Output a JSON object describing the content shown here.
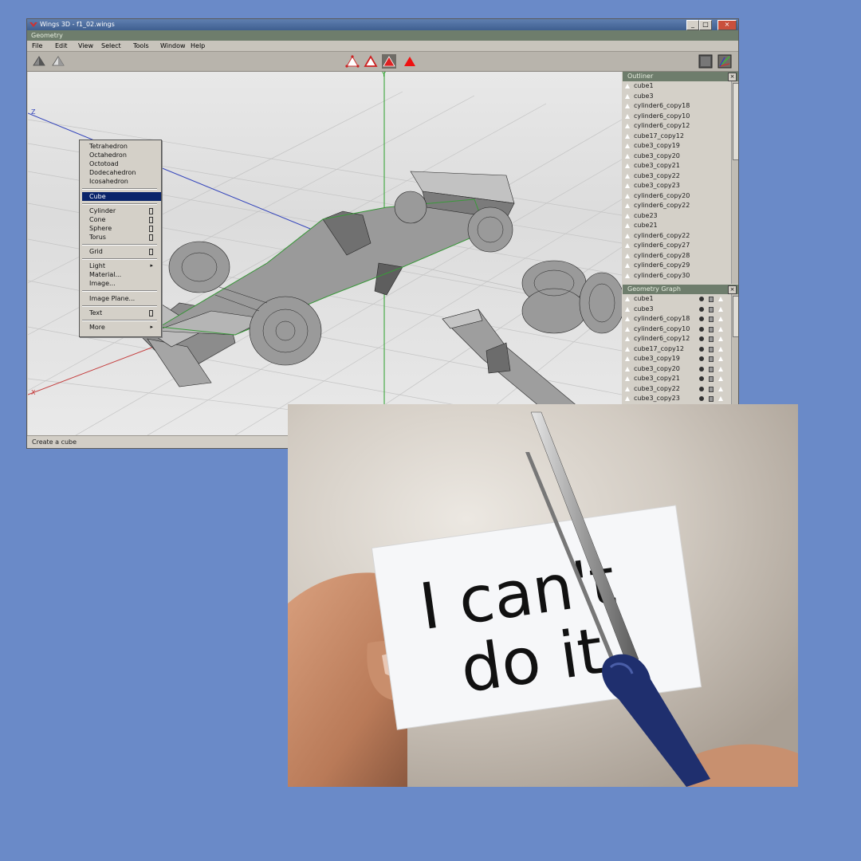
{
  "window": {
    "title": "Wings 3D - f1_02.wings",
    "geometry_bar": "Geometry",
    "controls": [
      "_",
      "□",
      "×"
    ]
  },
  "menubar": [
    "File",
    "Edit",
    "View",
    "Select",
    "Tools",
    "Window",
    "Help"
  ],
  "viewport": {
    "axis_labels": {
      "y": "Y",
      "z": "Z",
      "x": "X"
    }
  },
  "context_menu": {
    "items": [
      {
        "label": "Tetrahedron"
      },
      {
        "label": "Octahedron"
      },
      {
        "label": "Octotoad"
      },
      {
        "label": "Dodecahedron"
      },
      {
        "label": "Icosahedron"
      },
      {
        "label": "Cube",
        "highlighted": true
      },
      {
        "label": "Cylinder",
        "option_box": true
      },
      {
        "label": "Cone",
        "option_box": true
      },
      {
        "label": "Sphere",
        "option_box": true
      },
      {
        "label": "Torus",
        "option_box": true
      },
      {
        "label": "Grid",
        "option_box": true
      },
      {
        "label": "Light",
        "submenu": true
      },
      {
        "label": "Material..."
      },
      {
        "label": "Image..."
      },
      {
        "label": "Image Plane..."
      },
      {
        "label": "Text",
        "option_box": true
      },
      {
        "label": "More",
        "submenu": true
      }
    ]
  },
  "outliner": {
    "title": "Outliner",
    "items": [
      "cube1",
      "cube3",
      "cylinder6_copy18",
      "cylinder6_copy10",
      "cylinder6_copy12",
      "cube17_copy12",
      "cube3_copy19",
      "cube3_copy20",
      "cube3_copy21",
      "cube3_copy22",
      "cube3_copy23",
      "cylinder6_copy20",
      "cylinder6_copy22",
      "cube23",
      "cube21",
      "cylinder6_copy22",
      "cylinder6_copy27",
      "cylinder6_copy28",
      "cylinder6_copy29",
      "cylinder6_copy30"
    ]
  },
  "geometry_graph": {
    "title": "Geometry Graph",
    "items": [
      "cube1",
      "cube3",
      "cylinder6_copy18",
      "cylinder6_copy10",
      "cylinder6_copy12",
      "cube17_copy12",
      "cube3_copy19",
      "cube3_copy20",
      "cube3_copy21",
      "cube3_copy22",
      "cube3_copy23"
    ]
  },
  "statusbar": {
    "text": "Create a cube"
  },
  "photo": {
    "card_text_line1": "I can't",
    "card_text_line2": "do it"
  },
  "colors": {
    "background": "#6a8ac8",
    "panel_header": "#6e7d6c",
    "menu_highlight": "#0a246a",
    "scissors_handle": "#1f2f6e",
    "selection_green": "#3a9a3a"
  }
}
